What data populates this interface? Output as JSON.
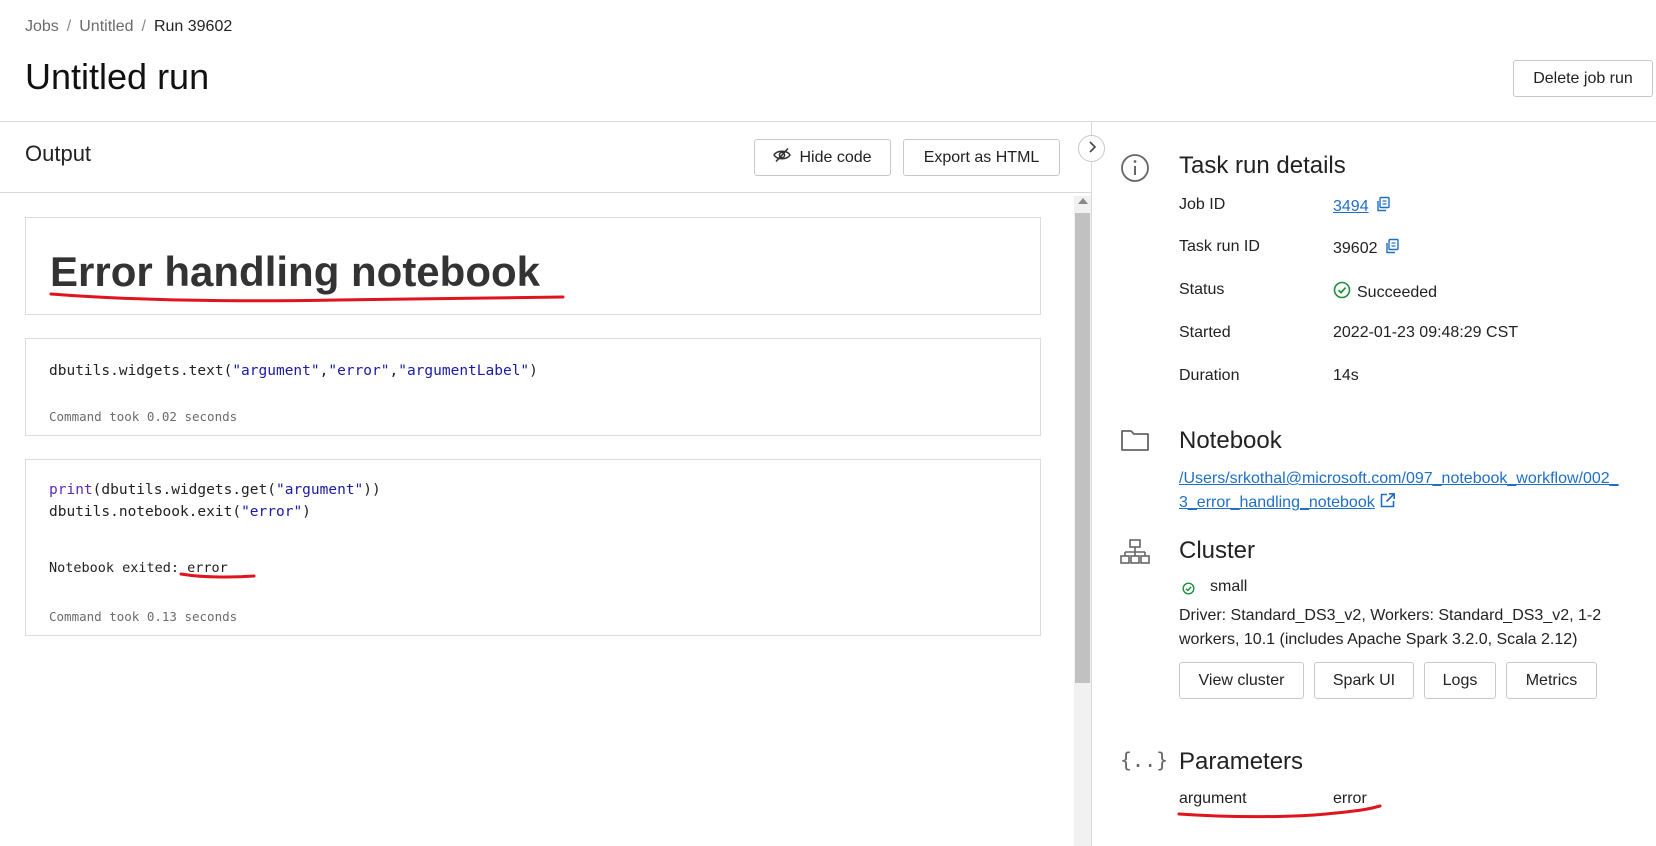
{
  "breadcrumb": {
    "jobs": "Jobs",
    "untitled": "Untitled",
    "current": "Run 39602",
    "separator": "/"
  },
  "page": {
    "title": "Untitled run",
    "delete_label": "Delete job run"
  },
  "output": {
    "title": "Output",
    "hide_code_label": "Hide code",
    "export_label": "Export as HTML",
    "markdown_heading": "Error handling notebook",
    "cell1": {
      "code_prefix": "dbutils.widgets.text(",
      "arg1": "\"argument\"",
      "comma1": ",",
      "arg2": "\"error\"",
      "comma2": ",",
      "arg3": "\"argumentLabel\"",
      "code_suffix": ")",
      "took": "Command took 0.02 seconds"
    },
    "cell2": {
      "line1_kw": "print",
      "line1_mid": "(dbutils.widgets.get(",
      "line1_str": "\"argument\"",
      "line1_end": "))",
      "line2_prefix": "dbutils.notebook.exit(",
      "line2_str": "\"error\"",
      "line2_end": ")",
      "exit_text": "Notebook exited: error",
      "took": "Command took 0.13 seconds"
    }
  },
  "details": {
    "task_run": {
      "title": "Task run details",
      "job_id_label": "Job ID",
      "job_id": "3494",
      "task_run_id_label": "Task run ID",
      "task_run_id": "39602",
      "status_label": "Status",
      "status": "Succeeded",
      "started_label": "Started",
      "started": "2022-01-23 09:48:29 CST",
      "duration_label": "Duration",
      "duration": "14s"
    },
    "notebook": {
      "title": "Notebook",
      "path_line1": "/Users/srkothal@microsoft.com/097_notebook_workflow/002_",
      "path_line2": "3_error_handling_notebook"
    },
    "cluster": {
      "title": "Cluster",
      "name": "small",
      "description": "Driver: Standard_DS3_v2, Workers: Standard_DS3_v2, 1-2 workers, 10.1 (includes Apache Spark 3.2.0, Scala 2.12)",
      "buttons": [
        "View cluster",
        "Spark UI",
        "Logs",
        "Metrics"
      ]
    },
    "parameters": {
      "title": "Parameters",
      "key": "argument",
      "value": "error"
    }
  },
  "colors": {
    "link": "#1f6fc5",
    "success": "#1e8e3e",
    "annotation": "#e0141e"
  },
  "icons": [
    "eye-slash-icon",
    "chevron-right-icon",
    "info-icon",
    "copy-icon",
    "check-circle-icon",
    "folder-icon",
    "external-link-icon",
    "cluster-icon",
    "braces-icon"
  ]
}
